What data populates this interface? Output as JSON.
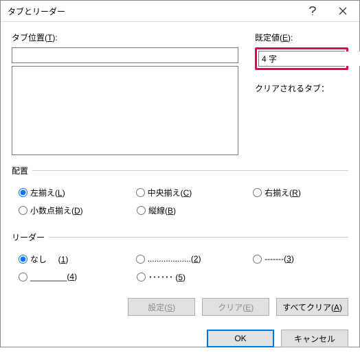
{
  "window": {
    "title": "タブとリーダー"
  },
  "labels": {
    "tab_position": "タブ位置(",
    "tab_position_u": "T",
    "tab_position_end": "):",
    "default": "既定値(",
    "default_u": "E",
    "default_end": "):",
    "cleared_tabs": "クリアされるタブ：",
    "alignment": "配置",
    "leader": "リーダー"
  },
  "values": {
    "tab_position_input": "",
    "default_value": "4 字"
  },
  "alignment_options": {
    "left": "左揃え(",
    "left_u": "L",
    "center": "中央揃え(",
    "center_u": "C",
    "right": "右揃え(",
    "right_u": "R",
    "decimal": "小数点揃え(",
    "decimal_u": "D",
    "bar": "縦線(",
    "bar_u": "B",
    "close": ")"
  },
  "leader_options": {
    "none": "なし",
    "n1": "1",
    "dots": "...................(",
    "n2": "2",
    "dashes": "-------(",
    "n3": "3",
    "underline": "________(",
    "n4": "4",
    "middots": "･･････ (",
    "n5": "5",
    "close": ")"
  },
  "buttons": {
    "set": "設定(",
    "set_u": "S",
    "clear": "クリア(",
    "clear_u": "E",
    "clear_all": "すべてクリア(",
    "clear_all_u": "A",
    "close_p": ")",
    "ok": "OK",
    "cancel": "キャンセル"
  }
}
